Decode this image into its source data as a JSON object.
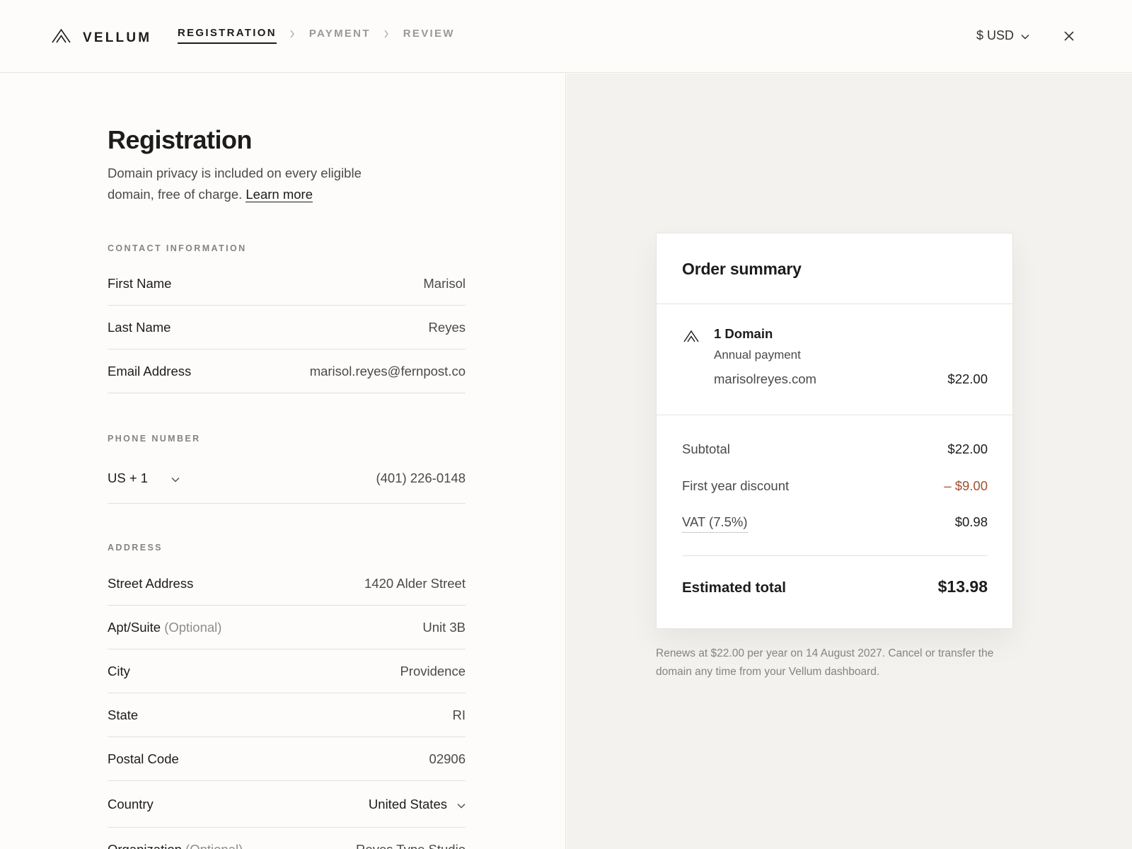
{
  "brand": {
    "name": "VELLUM",
    "logo_icon": "vellum-mountain-logo"
  },
  "steps": [
    {
      "label": "REGISTRATION",
      "active": true
    },
    {
      "label": "PAYMENT",
      "active": false
    },
    {
      "label": "REVIEW",
      "active": false
    }
  ],
  "header": {
    "currency": "$ USD"
  },
  "form": {
    "title": "Registration",
    "intro_text": "Domain privacy is included on every eligible domain, free of charge.",
    "intro_link": "Learn more",
    "contact": {
      "section": "CONTACT INFORMATION",
      "first_name": {
        "label": "First Name",
        "value": "Marisol"
      },
      "last_name": {
        "label": "Last Name",
        "value": "Reyes"
      },
      "email": {
        "label": "Email Address",
        "value": "marisol.reyes@fernpost.co"
      }
    },
    "phone": {
      "section": "PHONE NUMBER",
      "code": "US + 1",
      "number": "(401) 226-0148"
    },
    "address": {
      "section": "ADDRESS",
      "street": {
        "label": "Street Address",
        "value": "1420 Alder Street"
      },
      "apt": {
        "label": "Apt/Suite",
        "optional": "(Optional)",
        "value": "Unit 3B"
      },
      "city": {
        "label": "City",
        "value": "Providence"
      },
      "state": {
        "label": "State",
        "value": "RI"
      },
      "postal": {
        "label": "Postal Code",
        "value": "02906"
      },
      "country": {
        "label": "Country",
        "value": "United States"
      },
      "organization": {
        "label": "Organization",
        "optional": "(Optional)",
        "value": "Reyes Type Studio"
      }
    }
  },
  "summary": {
    "title": "Order summary",
    "item": {
      "name": "1 Domain",
      "billing": "Annual payment",
      "domain": "marisolreyes.com",
      "price": "$22.00"
    },
    "subtotal": {
      "label": "Subtotal",
      "value": "$22.00"
    },
    "discount": {
      "label": "First year discount",
      "value": "– $9.00"
    },
    "vat": {
      "label": "VAT (7.5%)",
      "value": "$0.98"
    },
    "total": {
      "label": "Estimated total",
      "value": "$13.98"
    },
    "note": "Renews at $22.00 per year on 14 August 2027. Cancel or transfer the domain any time from your Vellum dashboard."
  },
  "colors": {
    "discount": "#a0522d",
    "panel_bg": "#f3f2ef",
    "accent": "#1c1c1c"
  }
}
